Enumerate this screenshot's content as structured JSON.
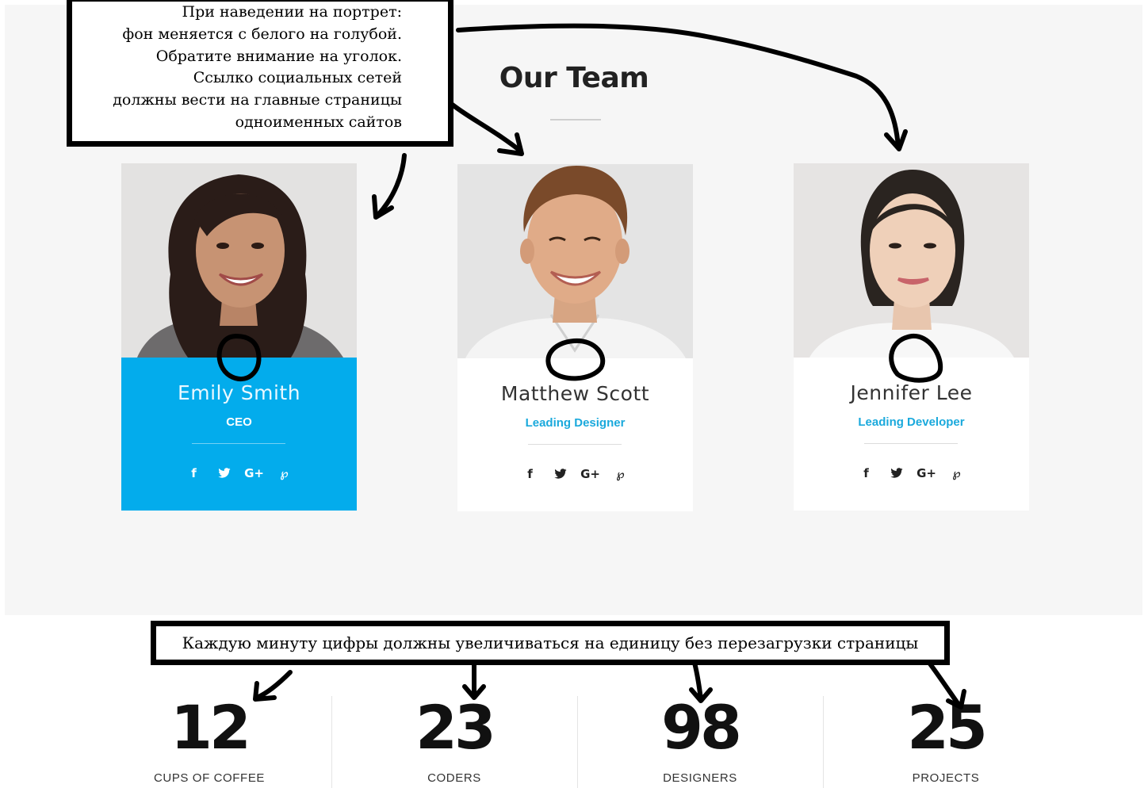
{
  "section": {
    "title": "Our Team"
  },
  "members": [
    {
      "name": "Emily Smith",
      "role": "CEO",
      "highlighted": true,
      "portrait": "woman-dark-hair-portrait"
    },
    {
      "name": "Matthew Scott",
      "role": "Leading Designer",
      "highlighted": false,
      "portrait": "man-smiling-portrait"
    },
    {
      "name": "Jennifer Lee",
      "role": "Leading Developer",
      "highlighted": false,
      "portrait": "woman-portrait"
    }
  ],
  "social_icons": {
    "facebook": "f",
    "twitter": "🐦",
    "google_plus": "G+",
    "pinterest": "℘"
  },
  "notes": {
    "top_lines": [
      "При наведении на портрет:",
      "фон меняется с белого на голубой.",
      "Обратите внимание на уголок.",
      "Ссылко социальных сетей",
      "должны вести на главные страницы",
      "одноименных сайтов"
    ],
    "bottom": "Каждую минуту цифры должны увеличиваться на единицу без перезагрузки страницы"
  },
  "stats": [
    {
      "number": "12",
      "label": "CUPS OF COFFEE"
    },
    {
      "number": "23",
      "label": "CODERS"
    },
    {
      "number": "98",
      "label": "DESIGNERS"
    },
    {
      "number": "25",
      "label": "PROJECTS"
    }
  ],
  "colors": {
    "accent": "#03acec",
    "role_text": "#1aa9dc",
    "section_bg": "#f6f6f6",
    "annotation_ink": "#000000"
  }
}
